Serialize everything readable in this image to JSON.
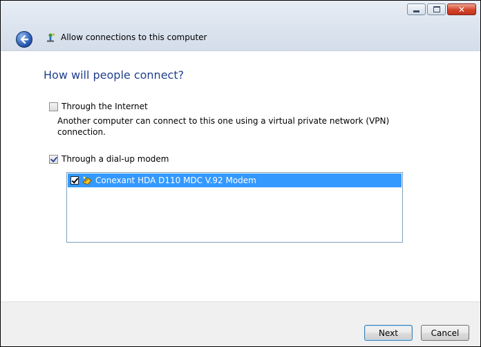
{
  "window": {
    "title": "Allow connections to this computer",
    "controls": [
      "minimize-icon",
      "maximize-icon",
      "close-icon"
    ]
  },
  "page": {
    "heading": "How will people connect?",
    "options": [
      {
        "label": "Through the Internet",
        "checked": false,
        "description": "Another computer can connect to this one using a virtual private network (VPN) connection."
      },
      {
        "label": "Through a dial-up modem",
        "checked": true
      }
    ],
    "modems": [
      {
        "label": "Conexant HDA D110 MDC V.92 Modem",
        "checked": true,
        "selected": true,
        "icon": "modem-icon"
      }
    ]
  },
  "footer": {
    "next_label": "Next",
    "cancel_label": "Cancel"
  },
  "colors": {
    "heading": "#1f3f8c",
    "selection": "#3399ff",
    "footer_bg": "#f0f0f0"
  }
}
